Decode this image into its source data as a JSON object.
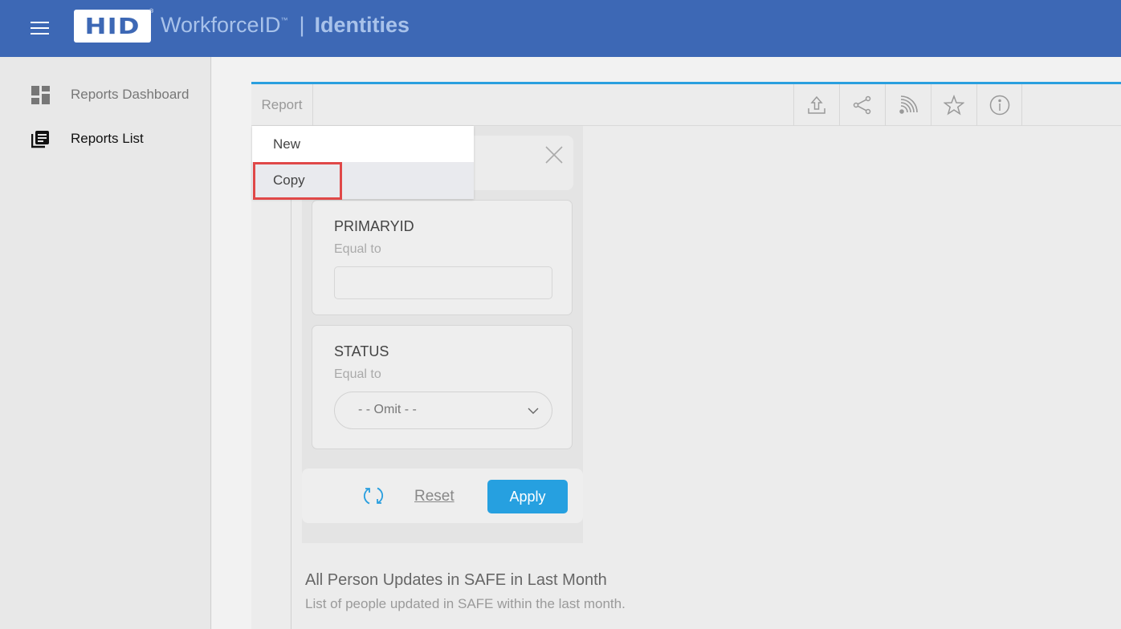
{
  "header": {
    "menu_icon": "hamburger-icon",
    "logo_text": "HID",
    "logo_mark": "®",
    "product": "WorkforceID",
    "product_tm": "™",
    "separator": "|",
    "section": "Identities",
    "color": "#3d68b5"
  },
  "sidebar": {
    "items": [
      {
        "label": "Reports Dashboard",
        "icon": "dashboard-icon",
        "active": false
      },
      {
        "label": "Reports List",
        "icon": "list-icon",
        "active": true
      }
    ]
  },
  "toolbar": {
    "report_label": "Report",
    "icons": [
      "export-icon",
      "share-icon",
      "rss-icon",
      "star-icon",
      "info-icon"
    ],
    "accent": "#2a9fdf"
  },
  "dropdown": {
    "items": [
      {
        "label": "New"
      },
      {
        "label": "Copy",
        "highlighted": true
      }
    ]
  },
  "filters": {
    "primaryid": {
      "title": "PRIMARYID",
      "operator": "Equal to",
      "value": ""
    },
    "status": {
      "title": "STATUS",
      "operator": "Equal to",
      "selected": "- - Omit - -"
    },
    "reset_label": "Reset",
    "apply_label": "Apply",
    "apply_color": "#26a0e0"
  },
  "report": {
    "title": "All Person Updates in SAFE in Last Month",
    "description": "List of people updated in SAFE within the last month."
  }
}
